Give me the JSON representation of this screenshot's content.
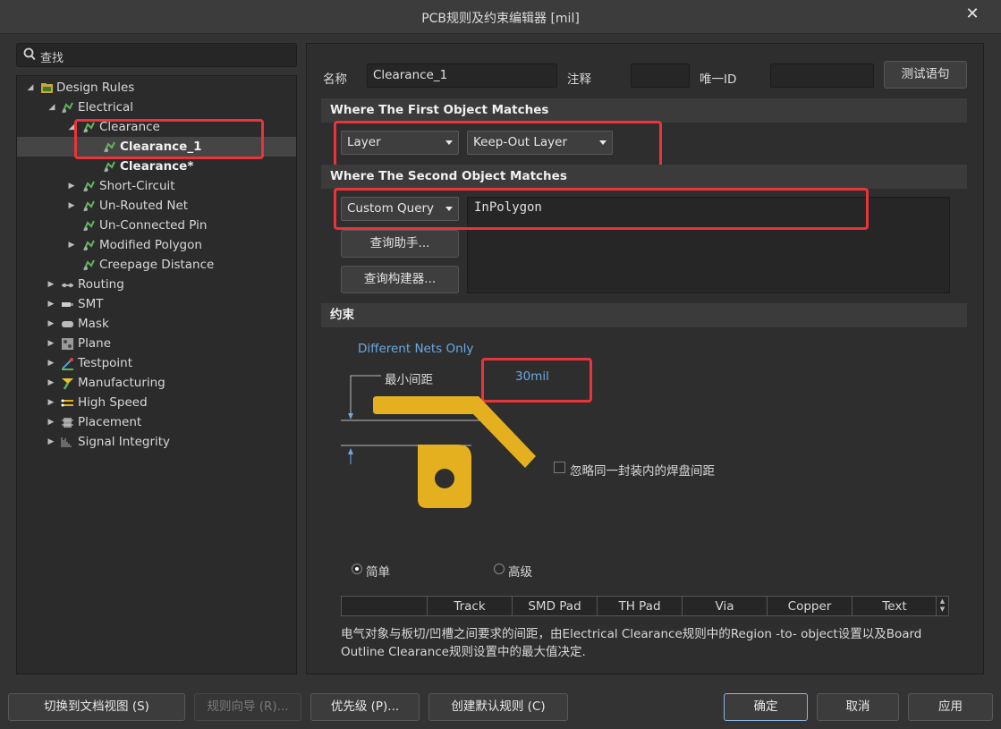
{
  "window": {
    "title": "PCB规则及约束编辑器 [mil]",
    "close_glyph": "✕"
  },
  "search": {
    "placeholder": "查找"
  },
  "tree": {
    "items": [
      {
        "label": "Design Rules",
        "icon": "design-rules-folder-icon"
      },
      {
        "label": "Electrical",
        "icon": "electrical-rule-icon"
      },
      {
        "label": "Clearance",
        "icon": "clearance-rule-icon"
      },
      {
        "label": "Clearance_1",
        "icon": "clearance-rule-icon"
      },
      {
        "label": "Clearance*",
        "icon": "clearance-rule-icon"
      },
      {
        "label": "Short-Circuit",
        "icon": "rule-icon"
      },
      {
        "label": "Un-Routed Net",
        "icon": "rule-icon"
      },
      {
        "label": "Un-Connected Pin",
        "icon": "rule-icon"
      },
      {
        "label": "Modified Polygon",
        "icon": "rule-icon"
      },
      {
        "label": "Creepage Distance",
        "icon": "rule-icon"
      },
      {
        "label": "Routing",
        "icon": "routing-icon"
      },
      {
        "label": "SMT",
        "icon": "smt-icon"
      },
      {
        "label": "Mask",
        "icon": "mask-icon"
      },
      {
        "label": "Plane",
        "icon": "plane-icon"
      },
      {
        "label": "Testpoint",
        "icon": "testpoint-icon"
      },
      {
        "label": "Manufacturing",
        "icon": "manufacturing-icon"
      },
      {
        "label": "High Speed",
        "icon": "high-speed-icon"
      },
      {
        "label": "Placement",
        "icon": "placement-icon"
      },
      {
        "label": "Signal Integrity",
        "icon": "signal-integrity-icon"
      }
    ]
  },
  "rule": {
    "name_label": "名称",
    "name_value": "Clearance_1",
    "comment_label": "注释",
    "comment_value": "",
    "uid_label": "唯一ID",
    "uid_value": "",
    "test_button": "测试语句"
  },
  "first_match": {
    "header": "Where The First Object Matches",
    "type": "Layer",
    "value": "Keep-Out Layer"
  },
  "second_match": {
    "header": "Where The Second Object Matches",
    "type": "Custom Query",
    "query": "InPolygon",
    "helper_button": "查询助手...",
    "builder_button": "查询构建器..."
  },
  "constraints": {
    "header": "约束",
    "net_scope": "Different Nets Only",
    "min_clearance_label": "最小间距",
    "min_clearance_value": "30mil",
    "ignore_pads_label": "忽略同一封装内的焊盘间距",
    "ignore_pads_checked": false,
    "mode_simple": "简单",
    "mode_advanced": "高级",
    "mode_selected": "simple",
    "grid_columns": [
      "",
      "Track",
      "SMD Pad",
      "TH Pad",
      "Via",
      "Copper",
      "Text"
    ],
    "description": "电气对象与板切/凹槽之间要求的间距，由Electrical Clearance规则中的Region -to- object设置以及Board Outline Clearance规则设置中的最大值决定."
  },
  "footer": {
    "switch_view": "切换到文档视图 (S)",
    "rule_wizard": "规则向导 (R)...",
    "priority": "优先级 (P)...",
    "create_default": "创建默认规则 (C)",
    "ok": "确定",
    "cancel": "取消",
    "apply": "应用"
  },
  "colors": {
    "highlight_red": "#e8343a",
    "link_blue": "#6aa9e4",
    "copper_yellow": "#e5b020"
  }
}
